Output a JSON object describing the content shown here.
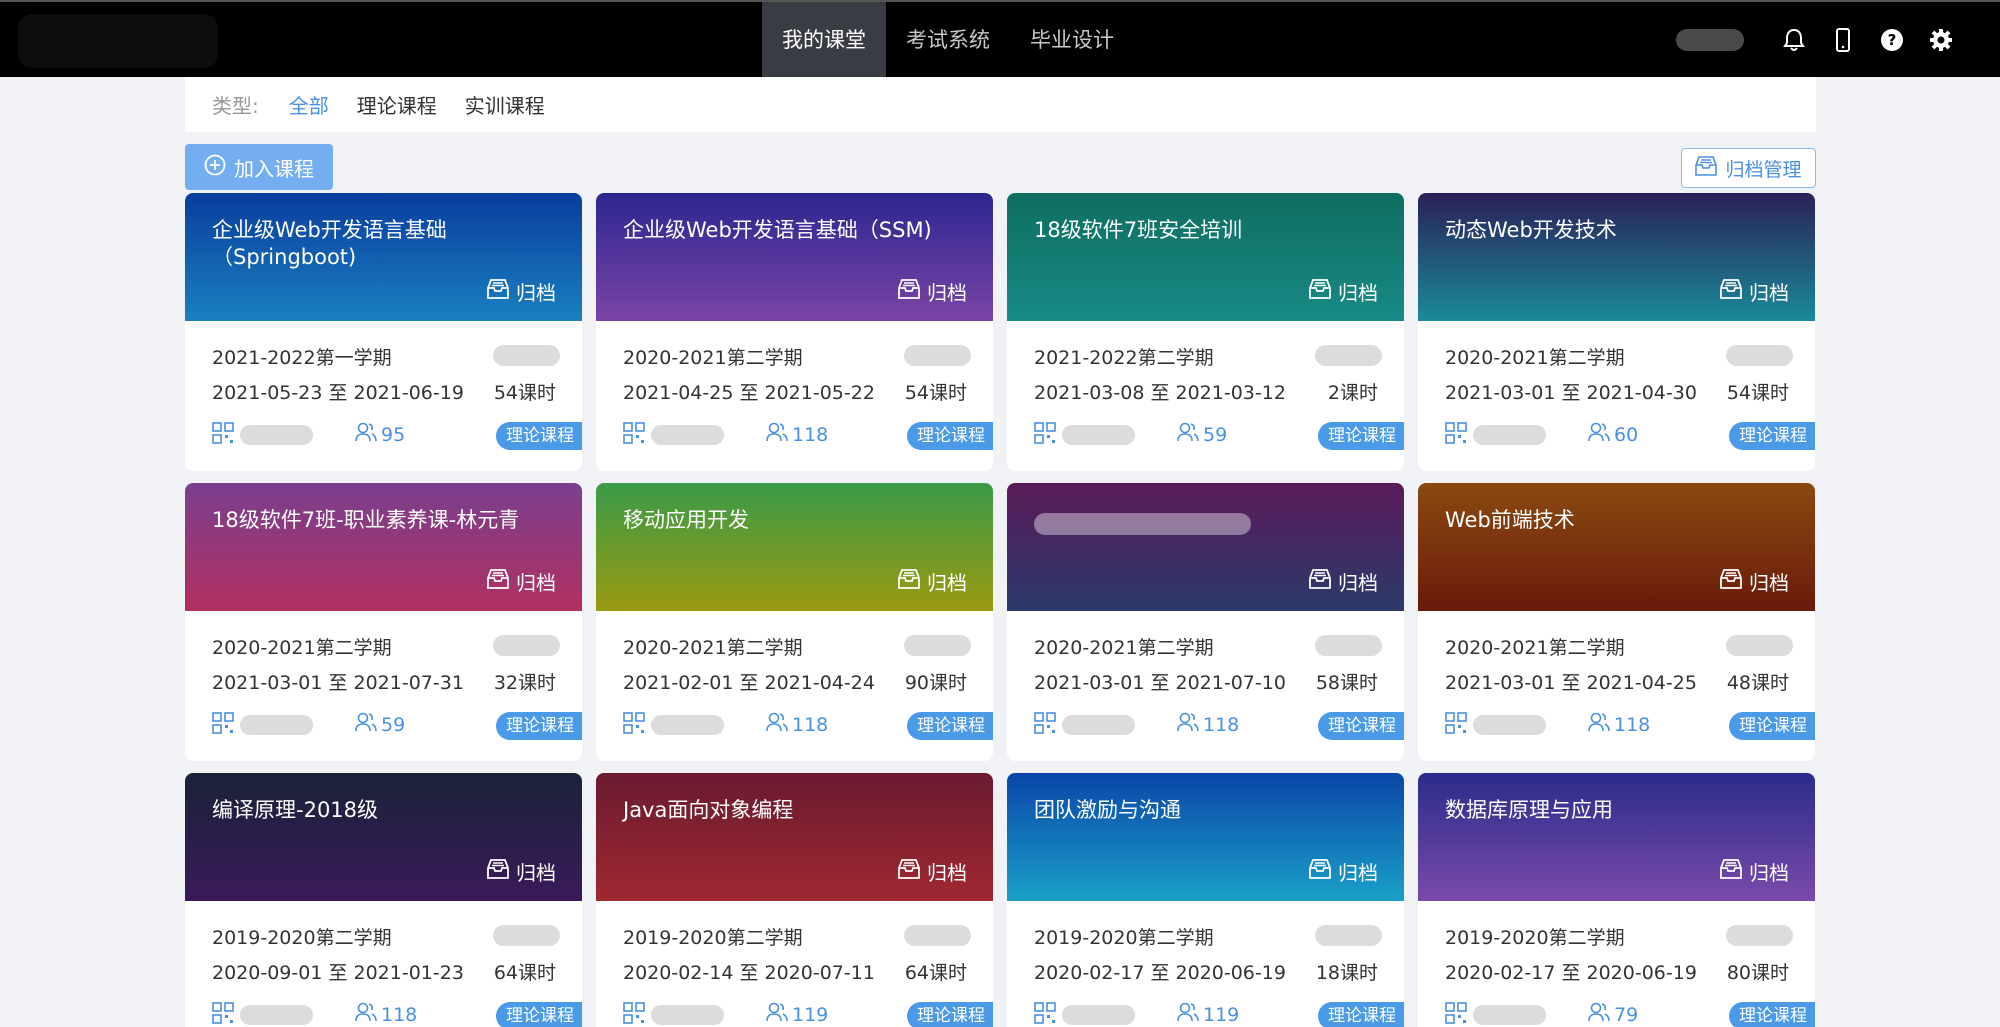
{
  "nav": {
    "items": [
      "我的课堂",
      "考试系统",
      "毕业设计"
    ],
    "active_index": 0
  },
  "toolbar_icons": [
    "bell-icon",
    "phone-icon",
    "help-icon",
    "settings-icon"
  ],
  "filter": {
    "label": "类型:",
    "options": [
      "全部",
      "理论课程",
      "实训课程"
    ],
    "active_index": 0
  },
  "actions": {
    "join_label": "加入课程",
    "archive_manage_label": "归档管理"
  },
  "archive_label": "归档",
  "colors": {
    "accent": "#4a90e2",
    "tag_bg": "#4a9ae8",
    "nav_bg": "#000000"
  },
  "courses": [
    {
      "title": "企业级Web开发语言基础（Springboot)",
      "semester": "2021-2022第一学期",
      "dates": "2021-05-23 至 2021-06-19",
      "hours": "54课时",
      "students": "95",
      "tag": "理论课程"
    },
    {
      "title": "企业级Web开发语言基础（SSM)",
      "semester": "2020-2021第二学期",
      "dates": "2021-04-25 至 2021-05-22",
      "hours": "54课时",
      "students": "118",
      "tag": "理论课程"
    },
    {
      "title": "18级软件7班安全培训",
      "semester": "2021-2022第二学期",
      "dates": "2021-03-08 至 2021-03-12",
      "hours": "2课时",
      "students": "59",
      "tag": "理论课程"
    },
    {
      "title": "动态Web开发技术",
      "semester": "2020-2021第二学期",
      "dates": "2021-03-01 至 2021-04-30",
      "hours": "54课时",
      "students": "60",
      "tag": "理论课程"
    },
    {
      "title": "18级软件7班-职业素养课-林元青",
      "semester": "2020-2021第二学期",
      "dates": "2021-03-01 至 2021-07-31",
      "hours": "32课时",
      "students": "59",
      "tag": "理论课程"
    },
    {
      "title": "移动应用开发",
      "semester": "2020-2021第二学期",
      "dates": "2021-02-01 至 2021-04-24",
      "hours": "90课时",
      "students": "118",
      "tag": "理论课程"
    },
    {
      "title": "",
      "semester": "2020-2021第二学期",
      "dates": "2021-03-01 至 2021-07-10",
      "hours": "58课时",
      "students": "118",
      "tag": "理论课程"
    },
    {
      "title": "Web前端技术",
      "semester": "2020-2021第二学期",
      "dates": "2021-03-01 至 2021-04-25",
      "hours": "48课时",
      "students": "118",
      "tag": "理论课程"
    },
    {
      "title": "编译原理-2018级",
      "semester": "2019-2020第二学期",
      "dates": "2020-09-01 至 2021-01-23",
      "hours": "64课时",
      "students": "118",
      "tag": "理论课程"
    },
    {
      "title": "Java面向对象编程",
      "semester": "2019-2020第二学期",
      "dates": "2020-02-14 至 2020-07-11",
      "hours": "64课时",
      "students": "119",
      "tag": "理论课程"
    },
    {
      "title": "团队激励与沟通",
      "semester": "2019-2020第二学期",
      "dates": "2020-02-17 至 2020-06-19",
      "hours": "18课时",
      "students": "119",
      "tag": "理论课程"
    },
    {
      "title": "数据库原理与应用",
      "semester": "2019-2020第二学期",
      "dates": "2020-02-17 至 2020-06-19",
      "hours": "80课时",
      "students": "79",
      "tag": "理论课程"
    }
  ]
}
